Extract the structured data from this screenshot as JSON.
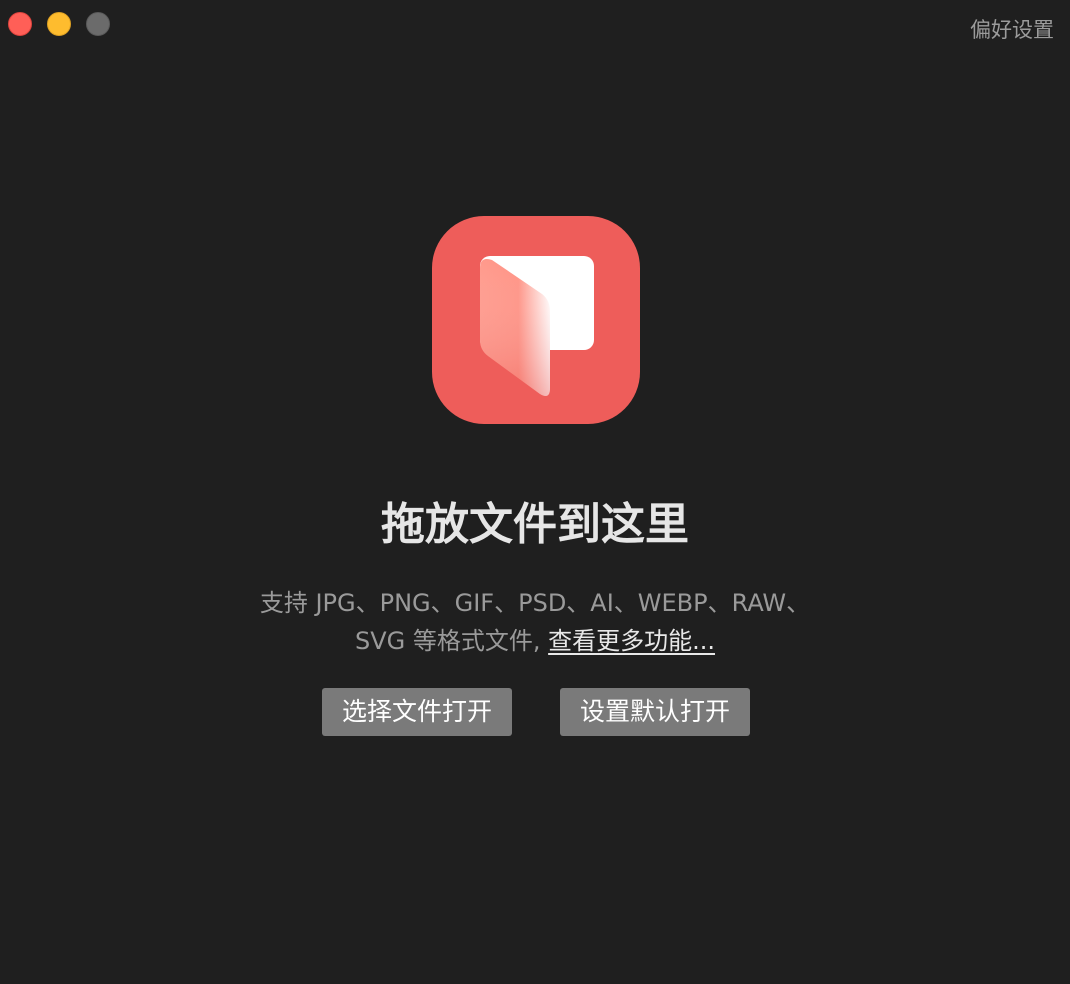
{
  "window": {
    "preferences_label": "偏好设置"
  },
  "main": {
    "title": "拖放文件到这里",
    "desc_line1": "支持 JPG、PNG、GIF、PSD、AI、WEBP、RAW、",
    "desc_line2_prefix": "SVG 等格式文件, ",
    "more_features_link": "查看更多功能..."
  },
  "buttons": {
    "open_file": "选择文件打开",
    "set_default": "设置默认打开"
  },
  "colors": {
    "background": "#1f1f1f",
    "icon_bg": "#ee5d5a",
    "button_bg": "#7a7a7a"
  }
}
